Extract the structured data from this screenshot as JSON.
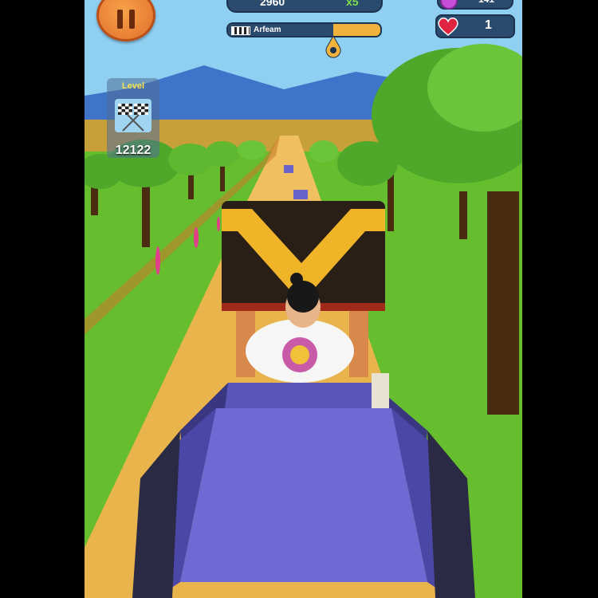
{
  "hud": {
    "pause_icon": "pause-icon",
    "score": "2960",
    "multiplier": "x5",
    "gems": "141",
    "lives": "1",
    "progress": {
      "fraction": 0.69,
      "label": "Arfeam"
    },
    "level": {
      "label": "Level",
      "number": "12122"
    }
  },
  "colors": {
    "accent": "#e0702a",
    "panel": "#2a4a6e",
    "progress": "#f2b33c",
    "grass": "#6cbf32",
    "road": "#e9b14a",
    "cart": "#6a63c9"
  }
}
